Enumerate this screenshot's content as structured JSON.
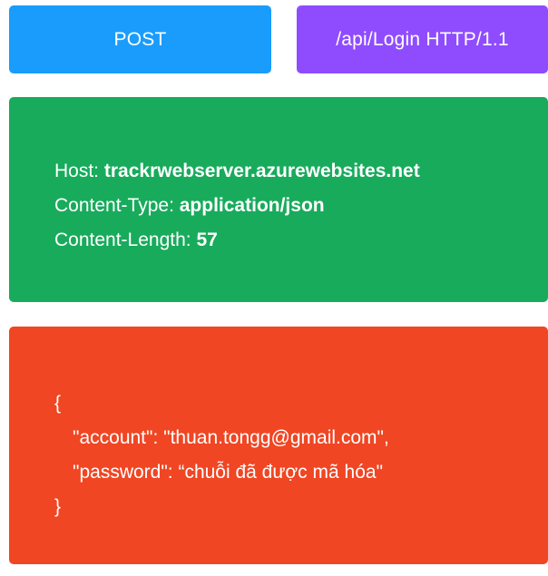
{
  "request_line": {
    "method": "POST",
    "path": "/api/Login HTTP/1.1"
  },
  "headers": [
    {
      "name": "Host: ",
      "value": "trackrwebserver.azurewebsites.net"
    },
    {
      "name": "Content-Type: ",
      "value": "application/json"
    },
    {
      "name": "Content-Length: ",
      "value": "57"
    }
  ],
  "body": {
    "open_brace": "{",
    "lines": [
      "\"account\": \"thuan.tongg@gmail.com\",",
      "\"password\": “chuỗi đã được mã hóa\""
    ],
    "close_brace": "}"
  },
  "colors": {
    "method_bg": "#1a9cfd",
    "path_bg": "#8f4cff",
    "headers_bg": "#18ab5c",
    "body_bg": "#f04623",
    "text": "#ffffff"
  }
}
